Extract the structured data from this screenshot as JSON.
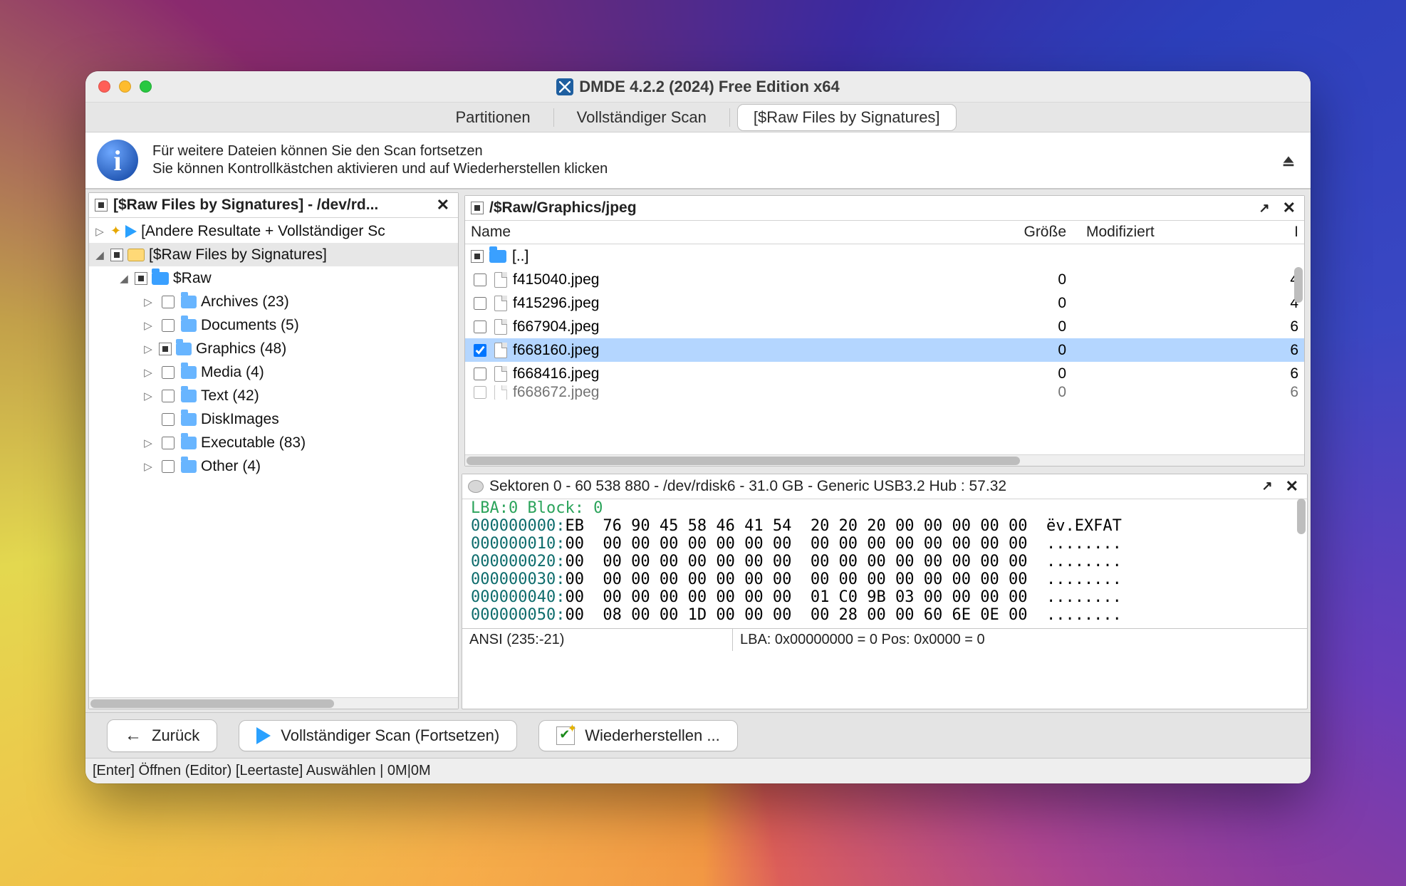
{
  "title": "DMDE 4.2.2 (2024) Free Edition x64",
  "tabs": {
    "partitions": "Partitionen",
    "fullscan": "Vollständiger Scan",
    "raw": "[$Raw Files by Signatures]"
  },
  "info": {
    "line1": "Für weitere Dateien können Sie den Scan fortsetzen",
    "line2": "Sie können Kontrollkästchen aktivieren und auf Wiederherstellen klicken"
  },
  "leftPane": {
    "title": "[$Raw Files by Signatures] - /dev/rd...",
    "row1": "[Andere Resultate + Vollständiger Sc",
    "row2": "[$Raw Files by Signatures]",
    "row3": "$Raw",
    "items": [
      {
        "label": "Archives (23)",
        "twisty": true,
        "cb": "empty"
      },
      {
        "label": "Documents (5)",
        "twisty": true,
        "cb": "empty"
      },
      {
        "label": "Graphics (48)",
        "twisty": true,
        "cb": "ind"
      },
      {
        "label": "Media (4)",
        "twisty": true,
        "cb": "empty"
      },
      {
        "label": "Text (42)",
        "twisty": true,
        "cb": "empty"
      },
      {
        "label": "DiskImages",
        "twisty": false,
        "cb": "empty"
      },
      {
        "label": "Executable (83)",
        "twisty": true,
        "cb": "empty"
      },
      {
        "label": "Other (4)",
        "twisty": true,
        "cb": "empty"
      }
    ]
  },
  "rightPane": {
    "title": "/$Raw/Graphics/jpeg",
    "cols": {
      "name": "Name",
      "size": "Größe",
      "date": "Modifiziert",
      "id": "I"
    },
    "updir": "[..]",
    "files": [
      {
        "name": "f415040.jpeg",
        "size": "0",
        "id": "4",
        "checked": false,
        "selected": false
      },
      {
        "name": "f415296.jpeg",
        "size": "0",
        "id": "4",
        "checked": false,
        "selected": false
      },
      {
        "name": "f667904.jpeg",
        "size": "0",
        "id": "6",
        "checked": false,
        "selected": false
      },
      {
        "name": "f668160.jpeg",
        "size": "0",
        "id": "6",
        "checked": true,
        "selected": true
      },
      {
        "name": "f668416.jpeg",
        "size": "0",
        "id": "6",
        "checked": false,
        "selected": false
      },
      {
        "name": "f668672.jpeg",
        "size": "0",
        "id": "6",
        "checked": false,
        "selected": false,
        "cut": true
      }
    ]
  },
  "hex": {
    "title": "Sektoren 0 - 60 538 880 - /dev/rdisk6 - 31.0 GB - Generic USB3.2 Hub : 57.32",
    "head": " LBA:0                   Block: 0",
    "lines": [
      "000000000:EB  76 90 45 58 46 41 54  20 20 20 00 00 00 00 00  ëv.EXFAT",
      "000000010:00  00 00 00 00 00 00 00  00 00 00 00 00 00 00 00  ........",
      "000000020:00  00 00 00 00 00 00 00  00 00 00 00 00 00 00 00  ........",
      "000000030:00  00 00 00 00 00 00 00  00 00 00 00 00 00 00 00  ........",
      "000000040:00  00 00 00 00 00 00 00  01 C0 9B 03 00 00 00 00  ........",
      "000000050:00  08 00 00 1D 00 00 00  00 28 00 00 60 6E 0E 00  ........"
    ],
    "status1": "ANSI (235:-21)",
    "status2": "LBA: 0x00000000 = 0  Pos: 0x0000 = 0"
  },
  "buttons": {
    "back": "Zurück",
    "scan": "Vollständiger Scan (Fortsetzen)",
    "recover": "Wiederherstellen ..."
  },
  "statusbar": "[Enter] Öffnen (Editor)   [Leertaste] Auswählen | 0M|0M"
}
